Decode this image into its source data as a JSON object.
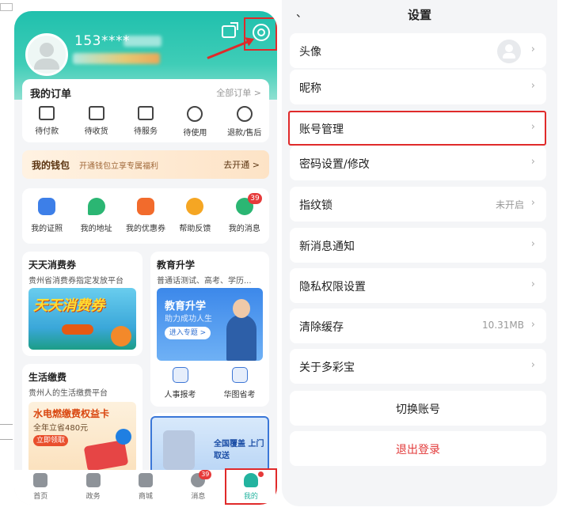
{
  "left": {
    "profile": {
      "phone": "153****"
    },
    "orders": {
      "title": "我的订单",
      "all_link": "全部订单 >",
      "items": [
        {
          "label": "待付款",
          "icon": "wallet-card-icon"
        },
        {
          "label": "待收货",
          "icon": "package-check-icon"
        },
        {
          "label": "待服务",
          "icon": "service-box-icon"
        },
        {
          "label": "待使用",
          "icon": "clock-icon"
        },
        {
          "label": "退款/售后",
          "icon": "refund-yen-icon"
        }
      ]
    },
    "wallet": {
      "title": "我的钱包",
      "desc": "开通钱包立享专属福利",
      "link": "去开通 >"
    },
    "services": [
      {
        "label": "我的证照",
        "icon": "id-card-icon",
        "color": "#3d7fe8"
      },
      {
        "label": "我的地址",
        "icon": "location-pin-icon",
        "color": "#2bb673"
      },
      {
        "label": "我的优惠券",
        "icon": "coupon-icon",
        "color": "#f26b2c"
      },
      {
        "label": "帮助反馈",
        "icon": "help-icon",
        "color": "#f5a623"
      },
      {
        "label": "我的消息",
        "icon": "message-icon",
        "color": "#2bb673",
        "badge": "39"
      }
    ],
    "tiles": {
      "coupon": {
        "title": "天天消费券",
        "sub": "贵州省消费券指定发放平台",
        "banner": "天天消费券"
      },
      "edu": {
        "title": "教育升学",
        "sub": "普通话测试、高考、学历...",
        "banner_title": "教育升学",
        "banner_sub": "助力成功人生",
        "banner_btn": "进入专题 >",
        "sub_items": [
          {
            "label": "人事报考"
          },
          {
            "label": "华图省考"
          }
        ]
      },
      "utility": {
        "title": "生活缴费",
        "sub": "贵州人的生活缴费平台",
        "banner_title": "水电燃缴费权益卡",
        "banner_sub": "全年立省480元",
        "banner_btn": "立即领取"
      },
      "promo": {
        "text": "全国覆盖 上门取送"
      }
    },
    "tabbar": [
      {
        "label": "首页",
        "icon": "home-icon"
      },
      {
        "label": "政务",
        "icon": "government-icon"
      },
      {
        "label": "商城",
        "icon": "shop-icon"
      },
      {
        "label": "消息",
        "icon": "message-icon",
        "badge": "39"
      },
      {
        "label": "我的",
        "icon": "profile-icon",
        "active": true
      }
    ]
  },
  "right": {
    "back": "、",
    "title": "设置",
    "rows": [
      {
        "label": "头像",
        "avatar": true
      },
      {
        "label": "昵称"
      },
      {
        "label": "账号管理"
      },
      {
        "label": "密码设置/修改"
      },
      {
        "label": "指纹锁",
        "value": "未开启"
      },
      {
        "label": "新消息通知"
      },
      {
        "label": "隐私权限设置"
      },
      {
        "label": "清除缓存",
        "value": "10.31MB"
      },
      {
        "label": "关于多彩宝"
      }
    ],
    "switch_account": "切换账号",
    "logout": "退出登录"
  },
  "colors": {
    "accent": "#23b39f",
    "highlight": "#e02a2a",
    "logout": "#e23b3b"
  }
}
